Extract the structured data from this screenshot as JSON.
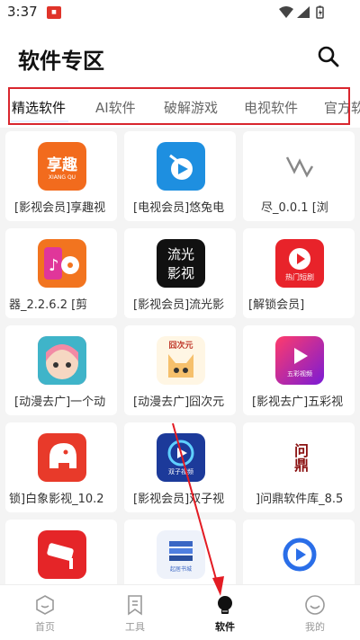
{
  "status_bar": {
    "time": "3:37",
    "notification_icon": "app-notification-icon",
    "icons": [
      "wifi-icon",
      "signal-icon",
      "battery-icon"
    ]
  },
  "header": {
    "title": "软件专区",
    "search_icon": "search-icon"
  },
  "tabs": [
    {
      "label": "精选软件",
      "active": true
    },
    {
      "label": "AI软件",
      "active": false
    },
    {
      "label": "破解游戏",
      "active": false
    },
    {
      "label": "电视软件",
      "active": false
    },
    {
      "label": "官方软",
      "active": false
    }
  ],
  "apps": [
    {
      "name": "[影视会员]享趣视",
      "icon": "xiangqu-logo-icon",
      "icon_text": "享趣",
      "icon_subtext": "XIANG QU",
      "color": "#f26b1d"
    },
    {
      "name": "[电视会员]悠兔电",
      "icon": "youtu-bird-play-icon",
      "color": "#1e8fe0"
    },
    {
      "name": "尽_0.0.1     [浏",
      "icon": "zigzag-line-icon",
      "color": "#ffffff"
    },
    {
      "name": "器_2.2.6.2     [剪",
      "icon": "music-film-icon",
      "color": "#f2741f"
    },
    {
      "name": "[影视会员]流光影",
      "icon": "liuguang-logo-icon",
      "icon_text": "流光",
      "icon_subtext": "影视",
      "color": "#111111"
    },
    {
      "name": "[解锁会员]",
      "icon": "hot-short-drama-icon",
      "icon_subtext": "热门短剧",
      "color": "#e8232a"
    },
    {
      "name": "[动漫去广]一个动",
      "icon": "anime-girl-icon",
      "color": "#f28aa5"
    },
    {
      "name": "[动漫去广]囧次元",
      "icon": "jiongciyuan-fox-icon",
      "icon_text": "囧次元",
      "color": "#f6c06c"
    },
    {
      "name": "[影视去广]五彩视",
      "icon": "wucai-play-icon",
      "icon_subtext": "五彩视频",
      "color": "#8a1bd6"
    },
    {
      "name": "锁]白象影视_10.2",
      "icon": "white-elephant-icon",
      "color": "#e83a2a"
    },
    {
      "name": "[影视会员]双子视",
      "icon": "shuangzi-play-icon",
      "icon_subtext": "双子视频",
      "color": "#1c3a9a"
    },
    {
      "name": "]问鼎软件库_8.5",
      "icon": "wending-calligraphy-icon",
      "icon_text": "问鼎",
      "color": "#ffffff"
    },
    {
      "name": "",
      "icon": "security-camera-icon",
      "color": "#e52528"
    },
    {
      "name": "",
      "icon": "books-icon",
      "icon_subtext": "起居书城",
      "color": "#eef2fa"
    },
    {
      "name": "",
      "icon": "blue-replay-icon",
      "color": "#ffffff"
    }
  ],
  "bottom_nav": [
    {
      "label": "首页",
      "icon": "home-hexagon-icon",
      "active": false
    },
    {
      "label": "工具",
      "icon": "bookmark-tool-icon",
      "active": false
    },
    {
      "label": "软件",
      "icon": "lightbulb-icon",
      "active": true
    },
    {
      "label": "我的",
      "icon": "smiley-profile-icon",
      "active": false
    }
  ],
  "colors": {
    "accent": "#d9262e",
    "arrow": "#e31b23",
    "background": "#f4f4f4"
  }
}
